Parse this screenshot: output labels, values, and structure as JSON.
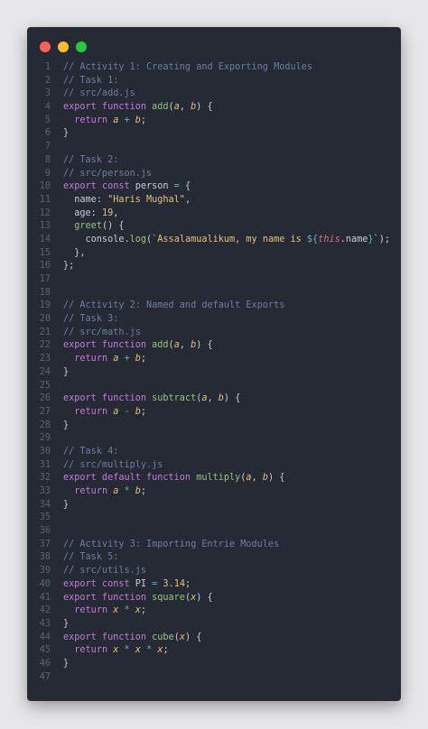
{
  "window": {
    "controls": [
      "close",
      "minimize",
      "maximize"
    ],
    "colors": {
      "close": "#ff5f56",
      "minimize": "#ffbd2e",
      "maximize": "#27c93f",
      "background": "#262a35"
    }
  },
  "lines": [
    {
      "n": "1",
      "tokens": [
        [
          "cm",
          "// Activity 1: Creating and Exporting Modules"
        ]
      ]
    },
    {
      "n": "2",
      "tokens": [
        [
          "cm",
          "// Task 1:"
        ]
      ]
    },
    {
      "n": "3",
      "tokens": [
        [
          "cm",
          "// src/add.js"
        ]
      ]
    },
    {
      "n": "4",
      "tokens": [
        [
          "kw",
          "export function "
        ],
        [
          "fn",
          "add"
        ],
        [
          "pl",
          "("
        ],
        [
          "pm",
          "a"
        ],
        [
          "pl",
          ", "
        ],
        [
          "pm",
          "b"
        ],
        [
          "pl",
          ") {"
        ]
      ]
    },
    {
      "n": "5",
      "tokens": [
        [
          "pl",
          "  "
        ],
        [
          "kw",
          "return "
        ],
        [
          "pm",
          "a"
        ],
        [
          "op",
          " + "
        ],
        [
          "pm",
          "b"
        ],
        [
          "pl",
          ";"
        ]
      ]
    },
    {
      "n": "6",
      "tokens": [
        [
          "pl",
          "}"
        ]
      ]
    },
    {
      "n": "7",
      "tokens": []
    },
    {
      "n": "8",
      "tokens": [
        [
          "cm",
          "// Task 2:"
        ]
      ]
    },
    {
      "n": "9",
      "tokens": [
        [
          "cm",
          "// src/person.js"
        ]
      ]
    },
    {
      "n": "10",
      "tokens": [
        [
          "kw",
          "export const "
        ],
        [
          "pl",
          "person "
        ],
        [
          "op",
          "="
        ],
        [
          "pl",
          " {"
        ]
      ]
    },
    {
      "n": "11",
      "tokens": [
        [
          "pl",
          "  name: "
        ],
        [
          "str",
          "\"Haris Mughal\""
        ],
        [
          "pl",
          ","
        ]
      ]
    },
    {
      "n": "12",
      "tokens": [
        [
          "pl",
          "  age: "
        ],
        [
          "num",
          "19"
        ],
        [
          "pl",
          ","
        ]
      ]
    },
    {
      "n": "13",
      "tokens": [
        [
          "pl",
          "  "
        ],
        [
          "fn",
          "greet"
        ],
        [
          "pl",
          "() {"
        ]
      ]
    },
    {
      "n": "14",
      "tokens": [
        [
          "pl",
          "    console."
        ],
        [
          "fn",
          "log"
        ],
        [
          "pl",
          "("
        ],
        [
          "str",
          "`Assalamualikum, my name is "
        ],
        [
          "op",
          "${"
        ],
        [
          "th",
          "this"
        ],
        [
          "pl",
          ".name"
        ],
        [
          "op",
          "}"
        ],
        [
          "str",
          "`"
        ],
        [
          "pl",
          ");"
        ]
      ]
    },
    {
      "n": "15",
      "tokens": [
        [
          "pl",
          "  },"
        ]
      ]
    },
    {
      "n": "16",
      "tokens": [
        [
          "pl",
          "};"
        ]
      ]
    },
    {
      "n": "17",
      "tokens": []
    },
    {
      "n": "18",
      "tokens": []
    },
    {
      "n": "19",
      "tokens": [
        [
          "cm",
          "// Activity 2: Named and default Exports"
        ]
      ]
    },
    {
      "n": "20",
      "tokens": [
        [
          "cm",
          "// Task 3:"
        ]
      ]
    },
    {
      "n": "21",
      "tokens": [
        [
          "cm",
          "// src/math.js"
        ]
      ]
    },
    {
      "n": "22",
      "tokens": [
        [
          "kw",
          "export function "
        ],
        [
          "fn",
          "add"
        ],
        [
          "pl",
          "("
        ],
        [
          "pm",
          "a"
        ],
        [
          "pl",
          ", "
        ],
        [
          "pm",
          "b"
        ],
        [
          "pl",
          ") {"
        ]
      ]
    },
    {
      "n": "23",
      "tokens": [
        [
          "pl",
          "  "
        ],
        [
          "kw",
          "return "
        ],
        [
          "pm",
          "a"
        ],
        [
          "op",
          " + "
        ],
        [
          "pm",
          "b"
        ],
        [
          "pl",
          ";"
        ]
      ]
    },
    {
      "n": "24",
      "tokens": [
        [
          "pl",
          "}"
        ]
      ]
    },
    {
      "n": "25",
      "tokens": []
    },
    {
      "n": "26",
      "tokens": [
        [
          "kw",
          "export function "
        ],
        [
          "fn",
          "subtract"
        ],
        [
          "pl",
          "("
        ],
        [
          "pm",
          "a"
        ],
        [
          "pl",
          ", "
        ],
        [
          "pm",
          "b"
        ],
        [
          "pl",
          ") {"
        ]
      ]
    },
    {
      "n": "27",
      "tokens": [
        [
          "pl",
          "  "
        ],
        [
          "kw",
          "return "
        ],
        [
          "pm",
          "a"
        ],
        [
          "op",
          " - "
        ],
        [
          "pm",
          "b"
        ],
        [
          "pl",
          ";"
        ]
      ]
    },
    {
      "n": "28",
      "tokens": [
        [
          "pl",
          "}"
        ]
      ]
    },
    {
      "n": "29",
      "tokens": []
    },
    {
      "n": "30",
      "tokens": [
        [
          "cm",
          "// Task 4:"
        ]
      ]
    },
    {
      "n": "31",
      "tokens": [
        [
          "cm",
          "// src/multiply.js"
        ]
      ]
    },
    {
      "n": "32",
      "tokens": [
        [
          "kw",
          "export default function "
        ],
        [
          "fn",
          "multiply"
        ],
        [
          "pl",
          "("
        ],
        [
          "pm",
          "a"
        ],
        [
          "pl",
          ", "
        ],
        [
          "pm",
          "b"
        ],
        [
          "pl",
          ") {"
        ]
      ]
    },
    {
      "n": "33",
      "tokens": [
        [
          "pl",
          "  "
        ],
        [
          "kw",
          "return "
        ],
        [
          "pm",
          "a"
        ],
        [
          "op",
          " * "
        ],
        [
          "pm",
          "b"
        ],
        [
          "pl",
          ";"
        ]
      ]
    },
    {
      "n": "34",
      "tokens": [
        [
          "pl",
          "}"
        ]
      ]
    },
    {
      "n": "35",
      "tokens": []
    },
    {
      "n": "36",
      "tokens": []
    },
    {
      "n": "37",
      "tokens": [
        [
          "cm",
          "// Activity 3: Importing Entrie Modules"
        ]
      ]
    },
    {
      "n": "38",
      "tokens": [
        [
          "cm",
          "// Task 5:"
        ]
      ]
    },
    {
      "n": "39",
      "tokens": [
        [
          "cm",
          "// src/utils.js"
        ]
      ]
    },
    {
      "n": "40",
      "tokens": [
        [
          "kw",
          "export const "
        ],
        [
          "pl",
          "PI "
        ],
        [
          "op",
          "="
        ],
        [
          "pl",
          " "
        ],
        [
          "num",
          "3.14"
        ],
        [
          "pl",
          ";"
        ]
      ]
    },
    {
      "n": "41",
      "tokens": [
        [
          "kw",
          "export function "
        ],
        [
          "fn",
          "square"
        ],
        [
          "pl",
          "("
        ],
        [
          "pm",
          "x"
        ],
        [
          "pl",
          ") {"
        ]
      ]
    },
    {
      "n": "42",
      "tokens": [
        [
          "pl",
          "  "
        ],
        [
          "kw",
          "return "
        ],
        [
          "pm",
          "x"
        ],
        [
          "op",
          " * "
        ],
        [
          "pm",
          "x"
        ],
        [
          "pl",
          ";"
        ]
      ]
    },
    {
      "n": "43",
      "tokens": [
        [
          "pl",
          "}"
        ]
      ]
    },
    {
      "n": "44",
      "tokens": [
        [
          "kw",
          "export function "
        ],
        [
          "fn",
          "cube"
        ],
        [
          "pl",
          "("
        ],
        [
          "pm",
          "x"
        ],
        [
          "pl",
          ") {"
        ]
      ]
    },
    {
      "n": "45",
      "tokens": [
        [
          "pl",
          "  "
        ],
        [
          "kw",
          "return "
        ],
        [
          "pm",
          "x"
        ],
        [
          "op",
          " * "
        ],
        [
          "pm",
          "x"
        ],
        [
          "op",
          " * "
        ],
        [
          "pm",
          "x"
        ],
        [
          "pl",
          ";"
        ]
      ]
    },
    {
      "n": "46",
      "tokens": [
        [
          "pl",
          "}"
        ]
      ]
    },
    {
      "n": "47",
      "tokens": []
    }
  ]
}
